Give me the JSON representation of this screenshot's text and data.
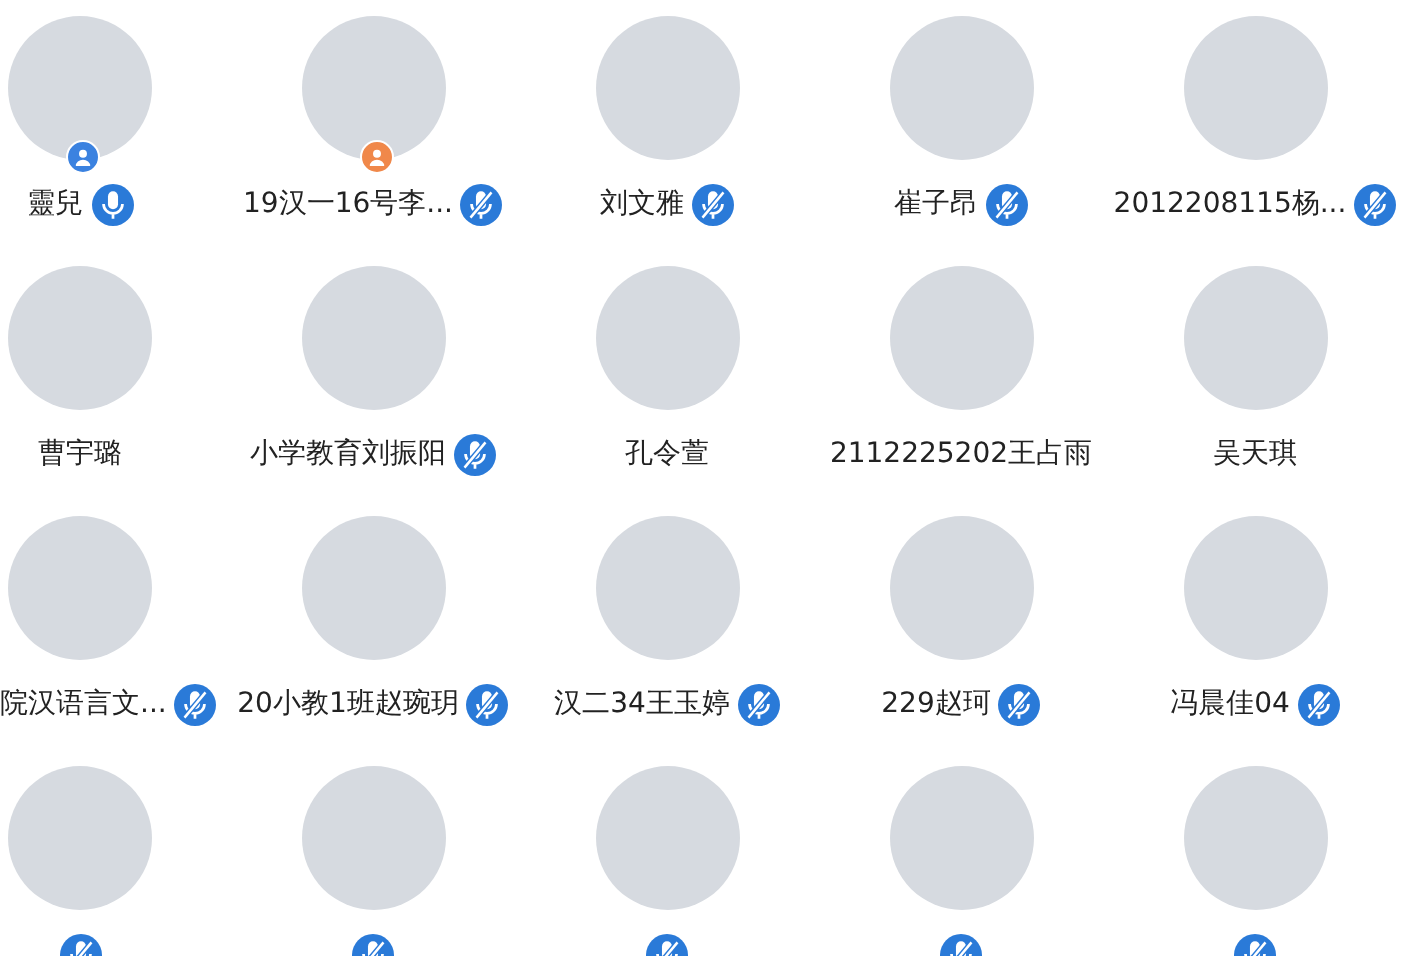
{
  "members": [
    {
      "name": "靈兒",
      "mic": {
        "muted": false
      },
      "badge": {
        "color": "#3b82e0"
      }
    },
    {
      "name": "19汉一16号李...",
      "mic": {
        "muted": true
      },
      "badge": {
        "color": "#f0884a"
      }
    },
    {
      "name": "刘文雅",
      "mic": {
        "muted": true
      }
    },
    {
      "name": "崔子昂",
      "mic": {
        "muted": true
      }
    },
    {
      "name": "2012208115杨...",
      "mic": {
        "muted": true
      }
    },
    {
      "name": "曹宇璐"
    },
    {
      "name": "小学教育刘振阳",
      "mic": {
        "muted": true
      }
    },
    {
      "name": "孔令萱"
    },
    {
      "name": "2112225202王占雨"
    },
    {
      "name": "吴天琪"
    },
    {
      "name": "院汉语言文...",
      "mic": {
        "muted": true
      }
    },
    {
      "name": "20小教1班赵琬玥",
      "mic": {
        "muted": true
      }
    },
    {
      "name": "汉二34王玉婷",
      "mic": {
        "muted": true
      }
    },
    {
      "name": "229赵珂",
      "mic": {
        "muted": true
      }
    },
    {
      "name": "冯晨佳04",
      "mic": {
        "muted": true
      }
    },
    {
      "mic": {
        "muted": true
      }
    },
    {
      "mic": {
        "muted": true
      }
    },
    {
      "mic": {
        "muted": true
      }
    },
    {
      "mic": {
        "muted": true
      }
    },
    {
      "mic": {
        "muted": true
      }
    }
  ]
}
